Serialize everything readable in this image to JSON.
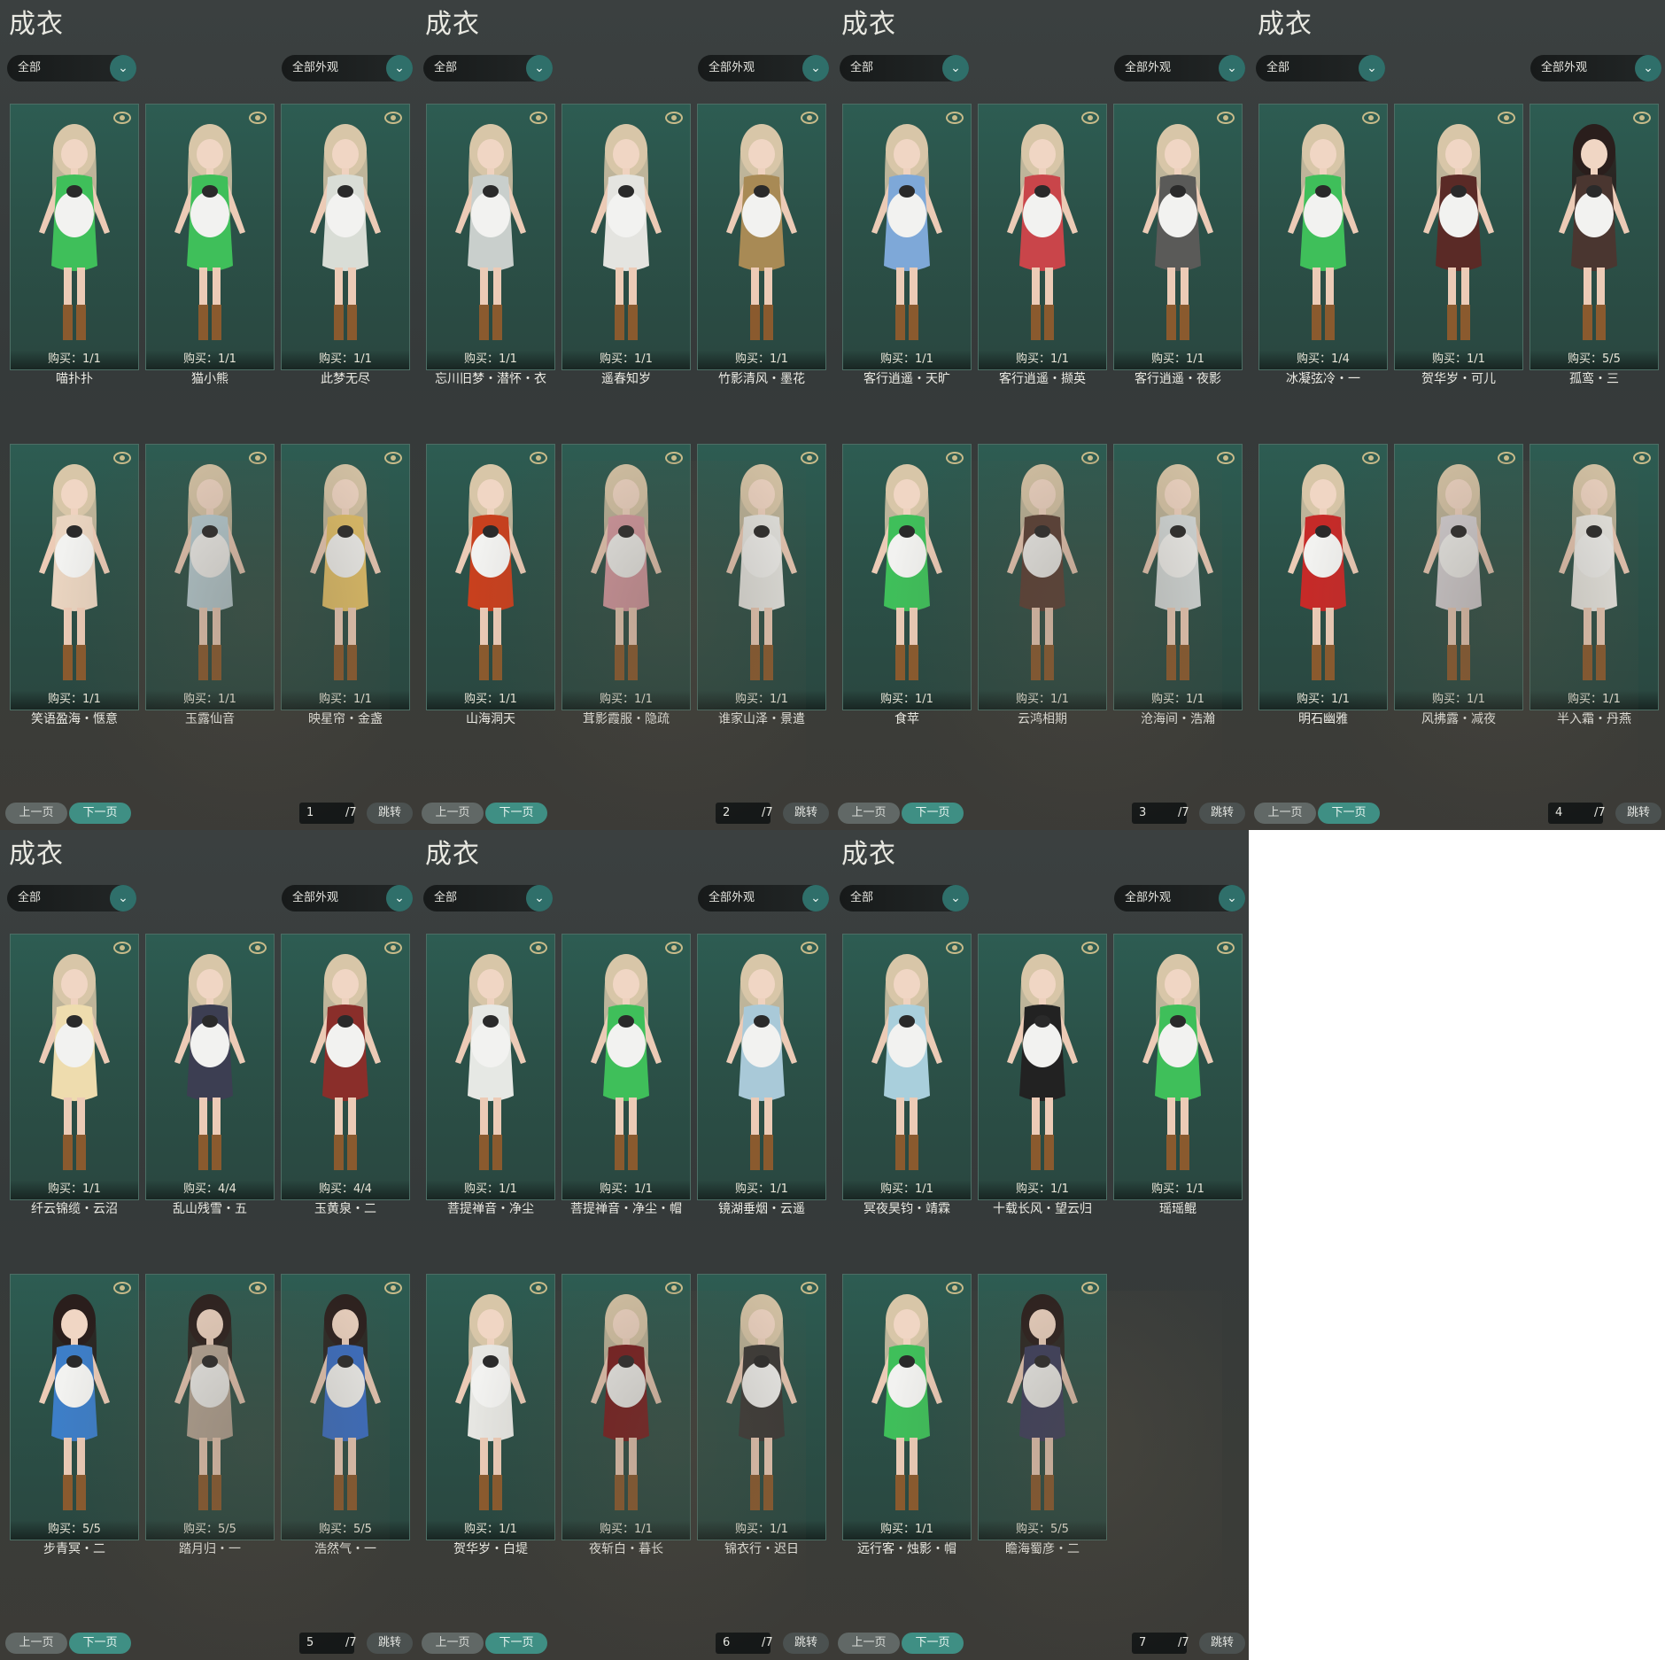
{
  "panel_common": {
    "title": "成衣",
    "filter_left": "全部",
    "filter_right": "全部外观",
    "prev_label": "上一页",
    "next_label": "下一页",
    "jump_label": "跳转",
    "page_total": "/7"
  },
  "colors": {
    "card_bg": "#2b5148",
    "accent_button": "#3f8f84",
    "eye_icon": "#c8bb8a"
  },
  "panels": [
    {
      "page": "1",
      "items": [
        {
          "name": "喵扑扑",
          "buy": "购买：1/1",
          "outfit": "#3fbf5a",
          "hair": "#d8c6a8"
        },
        {
          "name": "猫小熊",
          "buy": "购买：1/1",
          "outfit": "#3fbf5a",
          "hair": "#d8c6a8"
        },
        {
          "name": "此梦无尽",
          "buy": "购买：1/1",
          "outfit": "#d9ddd6",
          "hair": "#d8c6a8"
        },
        {
          "name": "笑语盈海・惬意",
          "buy": "购买：1/1",
          "outfit": "#e9d4c0",
          "hair": "#d8c6a8"
        },
        {
          "name": "玉露仙音",
          "buy": "购买：1/1",
          "outfit": "#b9cfd6",
          "hair": "#d8c6a8"
        },
        {
          "name": "映星帘・金盏",
          "buy": "购买：1/1",
          "outfit": "#e2c068",
          "hair": "#d8c6a8"
        }
      ]
    },
    {
      "page": "2",
      "items": [
        {
          "name": "忘川旧梦・潜怀・衣",
          "buy": "购买：1/1",
          "outfit": "#c9cfcc",
          "hair": "#d8c6a8"
        },
        {
          "name": "遥春知岁",
          "buy": "购买：1/1",
          "outfit": "#e4e4e0",
          "hair": "#d8c6a8"
        },
        {
          "name": "竹影清风・墨花",
          "buy": "购买：1/1",
          "outfit": "#a88a55",
          "hair": "#d8c6a8"
        },
        {
          "name": "山海洞天",
          "buy": "购买：1/1",
          "outfit": "#c8401e",
          "hair": "#d8c6a8"
        },
        {
          "name": "茸影霞服・隐疏",
          "buy": "购买：1/1",
          "outfit": "#d79aa2",
          "hair": "#d8c6a8"
        },
        {
          "name": "谁家山泽・景遣",
          "buy": "购买：1/1",
          "outfit": "#e8e8e4",
          "hair": "#d8c6a8"
        }
      ]
    },
    {
      "page": "3",
      "items": [
        {
          "name": "客行逍遥・天旷",
          "buy": "购买：1/1",
          "outfit": "#7ea8d8",
          "hair": "#d8c6a8"
        },
        {
          "name": "客行逍遥・撷英",
          "buy": "购买：1/1",
          "outfit": "#c9454a",
          "hair": "#d8c6a8"
        },
        {
          "name": "客行逍遥・夜影",
          "buy": "购买：1/1",
          "outfit": "#5a5a58",
          "hair": "#d8c6a8"
        },
        {
          "name": "食苹",
          "buy": "购买：1/1",
          "outfit": "#3fbf5a",
          "hair": "#d8c6a8"
        },
        {
          "name": "云鸿相期",
          "buy": "购买：1/1",
          "outfit": "#5a3e34",
          "hair": "#d8c6a8"
        },
        {
          "name": "沧海间・浩瀚",
          "buy": "购买：1/1",
          "outfit": "#d6dcdc",
          "hair": "#d8c6a8"
        }
      ]
    },
    {
      "page": "4",
      "items": [
        {
          "name": "冰凝弦冷・一",
          "buy": "购买：1/4",
          "outfit": "#3fbf5a",
          "hair": "#d8c6a8"
        },
        {
          "name": "贺华岁・可儿",
          "buy": "购买：1/1",
          "outfit": "#5a2a26",
          "hair": "#d8c6a8"
        },
        {
          "name": "孤鸾・三",
          "buy": "购买：5/5",
          "outfit": "#4a3630",
          "hair": "#2a1e1c"
        },
        {
          "name": "明石幽雅",
          "buy": "购买：1/1",
          "outfit": "#c62a28",
          "hair": "#d8c6a8"
        },
        {
          "name": "风拂露・减夜",
          "buy": "购买：1/1",
          "outfit": "#d8d4d8",
          "hair": "#d8c6a8"
        },
        {
          "name": "半入霜・丹燕",
          "buy": "购买：1/1",
          "outfit": "#ecebe6",
          "hair": "#d8c6a8"
        }
      ]
    },
    {
      "page": "5",
      "items": [
        {
          "name": "纤云锦缆・云沼",
          "buy": "购买：1/1",
          "outfit": "#eedcae",
          "hair": "#d8c6a8"
        },
        {
          "name": "乱山残雪・五",
          "buy": "购买：4/4",
          "outfit": "#3c3e52",
          "hair": "#d8c6a8"
        },
        {
          "name": "玉黄泉・二",
          "buy": "购买：4/4",
          "outfit": "#8a2e2a",
          "hair": "#d8c6a8"
        },
        {
          "name": "步青冥・二",
          "buy": "购买：5/5",
          "outfit": "#3d7ec8",
          "hair": "#2a1e1c"
        },
        {
          "name": "踏月归・一",
          "buy": "购买：5/5",
          "outfit": "#b8a898",
          "hair": "#2a1e1c"
        },
        {
          "name": "浩然气・一",
          "buy": "购买：5/5",
          "outfit": "#3a6fc6",
          "hair": "#2a1e1c"
        }
      ]
    },
    {
      "page": "6",
      "items": [
        {
          "name": "菩提禅音・净尘",
          "buy": "购买：1/1",
          "outfit": "#e6e8e4",
          "hair": "#d8c6a8"
        },
        {
          "name": "菩提禅音・净尘・帽",
          "buy": "购买：1/1",
          "outfit": "#3fbf5a",
          "hair": "#d8c6a8"
        },
        {
          "name": "镜湖垂烟・云遥",
          "buy": "购买：1/1",
          "outfit": "#a9c9d8",
          "hair": "#d8c6a8"
        },
        {
          "name": "贺华岁・白堤",
          "buy": "购买：1/1",
          "outfit": "#e6e6e2",
          "hair": "#d8c6a8"
        },
        {
          "name": "夜斩白・暮长",
          "buy": "购买：1/1",
          "outfit": "#7a1c1e",
          "hair": "#d8c6a8"
        },
        {
          "name": "锦衣行・迟日",
          "buy": "购买：1/1",
          "outfit": "#3a3836",
          "hair": "#d8c6a8"
        }
      ]
    },
    {
      "page": "7",
      "items": [
        {
          "name": "冥夜昊钧・靖霖",
          "buy": "购买：1/1",
          "outfit": "#a9cfdc",
          "hair": "#d8c6a8"
        },
        {
          "name": "十载长风・望云归",
          "buy": "购买：1/1",
          "outfit": "#222222",
          "hair": "#d8c6a8"
        },
        {
          "name": "瑶瑶鲲",
          "buy": "购买：1/1",
          "outfit": "#3fbf5a",
          "hair": "#d8c6a8"
        },
        {
          "name": "远行客・烛影・帽",
          "buy": "购买：1/1",
          "outfit": "#3fbf5a",
          "hair": "#d8c6a8"
        },
        {
          "name": "瞻海蜀彦・二",
          "buy": "购买：5/5",
          "outfit": "#3c3e5e",
          "hair": "#2a1e1c"
        }
      ]
    }
  ]
}
